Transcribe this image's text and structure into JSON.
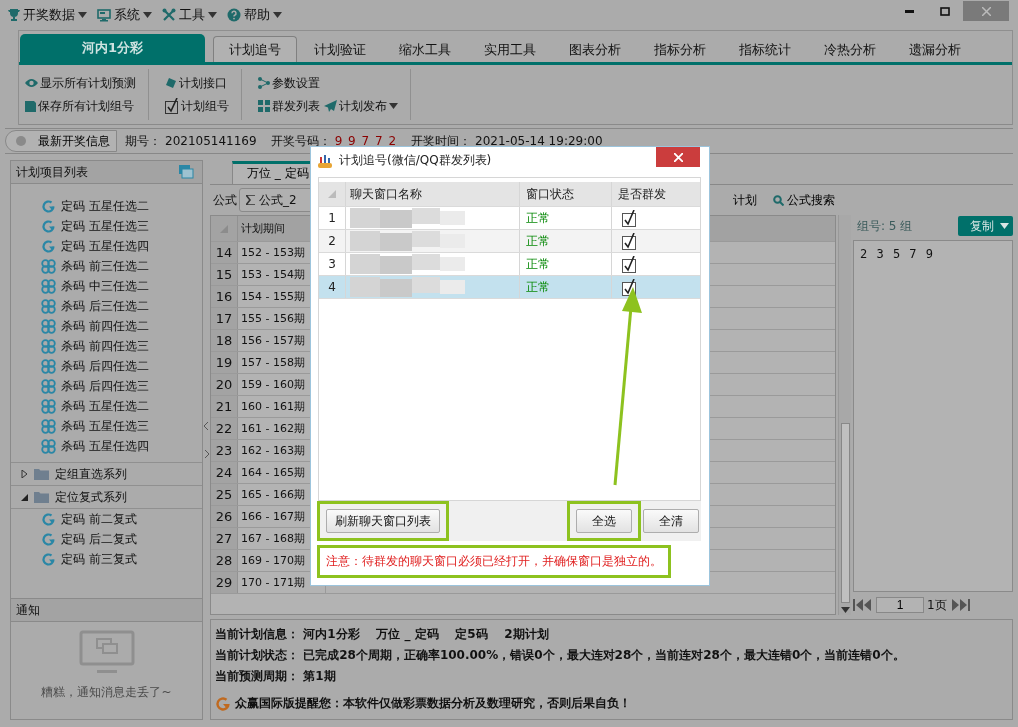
{
  "menu": [
    {
      "label": "开奖数据"
    },
    {
      "label": "系统"
    },
    {
      "label": "工具"
    },
    {
      "label": "帮助"
    }
  ],
  "lottery_tab": "河内1分彩",
  "tabs": [
    {
      "label": "计划追号",
      "selected": true
    },
    {
      "label": "计划验证",
      "selected": false
    },
    {
      "label": "缩水工具",
      "selected": false
    },
    {
      "label": "实用工具",
      "selected": false
    },
    {
      "label": "图表分析",
      "selected": false
    },
    {
      "label": "指标分析",
      "selected": false
    },
    {
      "label": "指标统计",
      "selected": false
    },
    {
      "label": "冷热分析",
      "selected": false
    },
    {
      "label": "遗漏分析",
      "selected": false
    }
  ],
  "ribbon": [
    [
      [
        {
          "label": "显示所有计划预测",
          "dropdown": false
        }
      ],
      [
        {
          "label": "保存所有计划组号",
          "dropdown": false
        }
      ]
    ],
    [
      [
        {
          "label": "计划接口",
          "dropdown": false
        }
      ],
      [
        {
          "label": "计划组号",
          "dropdown": false
        }
      ]
    ],
    [
      [
        {
          "label": "参数设置",
          "dropdown": false
        }
      ],
      [
        {
          "label": "群发列表",
          "dropdown": false
        },
        {
          "label": "计划发布",
          "dropdown": true
        }
      ]
    ]
  ],
  "info_bar": {
    "button": "最新开奖信息",
    "issue_label": "期号：",
    "issue": "202105141169",
    "draw_label": "开奖号码：",
    "draw": "9 9 7 7 2",
    "time_label": "开奖时间：",
    "time": "2021-05-14 19:29:00"
  },
  "sidebar": {
    "title": "计划项目列表",
    "items": [
      {
        "label": "定码 五星任选二",
        "kind": "dingma"
      },
      {
        "label": "定码 五星任选三",
        "kind": "dingma"
      },
      {
        "label": "定码 五星任选四",
        "kind": "dingma"
      },
      {
        "label": "杀码 前三任选二",
        "kind": "shama"
      },
      {
        "label": "杀码 中三任选二",
        "kind": "shama"
      },
      {
        "label": "杀码 后三任选二",
        "kind": "shama"
      },
      {
        "label": "杀码 前四任选二",
        "kind": "shama"
      },
      {
        "label": "杀码 前四任选三",
        "kind": "shama"
      },
      {
        "label": "杀码 后四任选二",
        "kind": "shama"
      },
      {
        "label": "杀码 后四任选三",
        "kind": "shama"
      },
      {
        "label": "杀码 五星任选二",
        "kind": "shama"
      },
      {
        "label": "杀码 五星任选三",
        "kind": "shama"
      },
      {
        "label": "杀码 五星任选四",
        "kind": "shama"
      },
      {
        "label": "定组直选系列",
        "kind": "folder",
        "expanded": false
      },
      {
        "label": "定位复式系列",
        "kind": "folder",
        "expanded": true,
        "children": [
          {
            "label": "定码 前二复式",
            "kind": "dingma"
          },
          {
            "label": "定码 后二复式",
            "kind": "dingma"
          },
          {
            "label": "定码 前三复式",
            "kind": "dingma"
          }
        ]
      }
    ]
  },
  "notice": {
    "title": "通知",
    "empty_text": "糟糕，通知消息走丢了~"
  },
  "plan_tab": "万位 _ 定码",
  "toolbar": {
    "formula_label": "公式",
    "formula": "公式_2",
    "plan_button": "计划",
    "search_button": "公式搜索"
  },
  "table": {
    "columns": [
      "计划期间"
    ],
    "rows": [
      {
        "index": "14",
        "period": "152 - 153期"
      },
      {
        "index": "15",
        "period": "153 - 154期"
      },
      {
        "index": "16",
        "period": "154 - 155期"
      },
      {
        "index": "17",
        "period": "155 - 156期"
      },
      {
        "index": "18",
        "period": "156 - 157期"
      },
      {
        "index": "19",
        "period": "157 - 158期"
      },
      {
        "index": "20",
        "period": "159 - 160期"
      },
      {
        "index": "21",
        "period": "160 - 161期"
      },
      {
        "index": "22",
        "period": "161 - 162期"
      },
      {
        "index": "23",
        "period": "162 - 163期"
      },
      {
        "index": "24",
        "period": "164 - 165期"
      },
      {
        "index": "25",
        "period": "165 - 166期"
      },
      {
        "index": "26",
        "period": "166 - 167期"
      },
      {
        "index": "27",
        "period": "167 - 168期"
      },
      {
        "index": "28",
        "period": "169 - 170期"
      },
      {
        "index": "29",
        "period": "170 - 171期"
      }
    ]
  },
  "group_panel": {
    "label": "组号: 5 组",
    "copy": "复制",
    "numbers": "2 3 5 7 9",
    "page": "1",
    "pages": "1页"
  },
  "summary": {
    "lines": [
      {
        "label": "当前计划信息：",
        "value": "河内1分彩    万位 _ 定码    定5码    2期计划"
      },
      {
        "label": "当前计划状态：",
        "value": "已完成28个周期，正确率100.00%，错误0个，最大连对28个，当前连对28个，最大连错0个，当前连错0个。"
      },
      {
        "label": "当前预测周期：",
        "value": "第1期"
      }
    ],
    "warning": "众赢国际版提醒您：本软件仅做彩票数据分析及数理研究，否则后果自负！"
  },
  "dialog": {
    "title": "计划追号(微信/QQ群发列表)",
    "columns": [
      "聊天窗口名称",
      "窗口状态",
      "是否群发"
    ],
    "rows": [
      {
        "index": "1",
        "status": "正常",
        "checked": true,
        "selected": false
      },
      {
        "index": "2",
        "status": "正常",
        "checked": true,
        "selected": false
      },
      {
        "index": "3",
        "status": "正常",
        "checked": true,
        "selected": false
      },
      {
        "index": "4",
        "status": "正常",
        "checked": true,
        "selected": true
      }
    ],
    "buttons": [
      {
        "label": "刷新聊天窗口列表",
        "highlighted": true
      },
      {
        "label": "全选",
        "highlighted": true
      },
      {
        "label": "全清",
        "highlighted": false
      }
    ],
    "note": {
      "text": "注意：待群发的聊天窗口必须已经打开，并确保窗口是独立的。",
      "highlighted": true
    }
  }
}
